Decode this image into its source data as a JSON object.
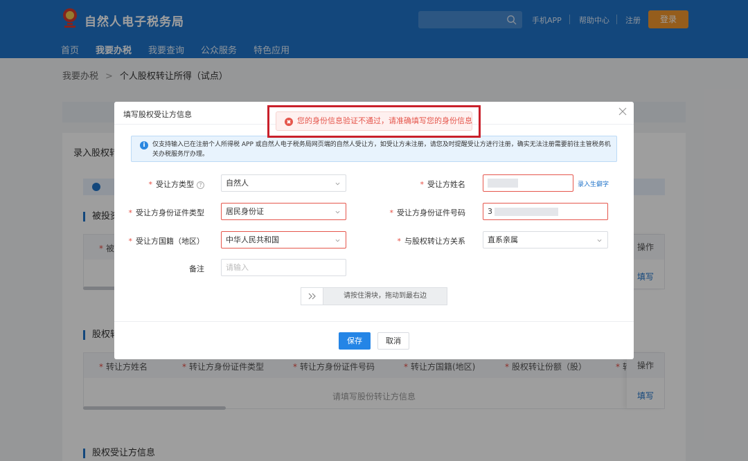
{
  "header": {
    "brand": "自然人电子税务局",
    "links": [
      "手机APP",
      "帮助中心",
      "注册"
    ],
    "login_label": "登录",
    "nav": [
      "首页",
      "我要办税",
      "我要查询",
      "公众服务",
      "特色应用"
    ]
  },
  "breadcrumb": {
    "parent": "我要办税",
    "separator": ">",
    "current": "个人股权转让所得（试点）"
  },
  "background": {
    "panel_title": "录入股权转",
    "section1_title": "被投资",
    "section1_col1": "被",
    "section2_title": "股权转",
    "section2_columns": [
      "转让方姓名",
      "转让方身份证件类型",
      "转让方身份证件号码",
      "转让方国籍(地区)",
      "股权转让份额（股）",
      "转"
    ],
    "section2_empty": "请填写股份转让方信息",
    "section3_title": "股权受让方信息",
    "op_header": "操作",
    "op_link": "填写"
  },
  "dialog": {
    "title": "填写股权受让方信息",
    "notice": "仅支持输入已在注册个人所得税 APP 或自然人电子税务局网页端的自然人受让方，如受让方未注册，请您及时提醒受让方进行注册，确实无法注册需要前往主管税务机关办税服务厅办理。",
    "fields": {
      "transferee_type": {
        "label": "受让方类型",
        "value": "自然人"
      },
      "transferee_name": {
        "label": "受让方姓名",
        "link": "录入生僻字"
      },
      "id_type": {
        "label": "受让方身份证件类型",
        "value": "居民身份证"
      },
      "id_number": {
        "label": "受让方身份证件号码",
        "value": "3"
      },
      "nationality": {
        "label": "受让方国籍（地区）",
        "value": "中华人民共和国"
      },
      "relation": {
        "label": "与股权转让方关系",
        "value": "直系亲属"
      },
      "remark": {
        "label": "备注",
        "placeholder": "请输入"
      }
    },
    "slider_text": "请按住滑块，拖动到最右边",
    "save_label": "保存",
    "cancel_label": "取消"
  },
  "toast": {
    "message": "您的身份信息验证不通过，请准确填写您的身份信息",
    "type": "error"
  },
  "colors": {
    "header_blue": "#1f73c9",
    "login_orange": "#f0962e",
    "error_red": "#e5564c",
    "primary_blue": "#2485e6",
    "highlight_red": "#c9202b"
  }
}
